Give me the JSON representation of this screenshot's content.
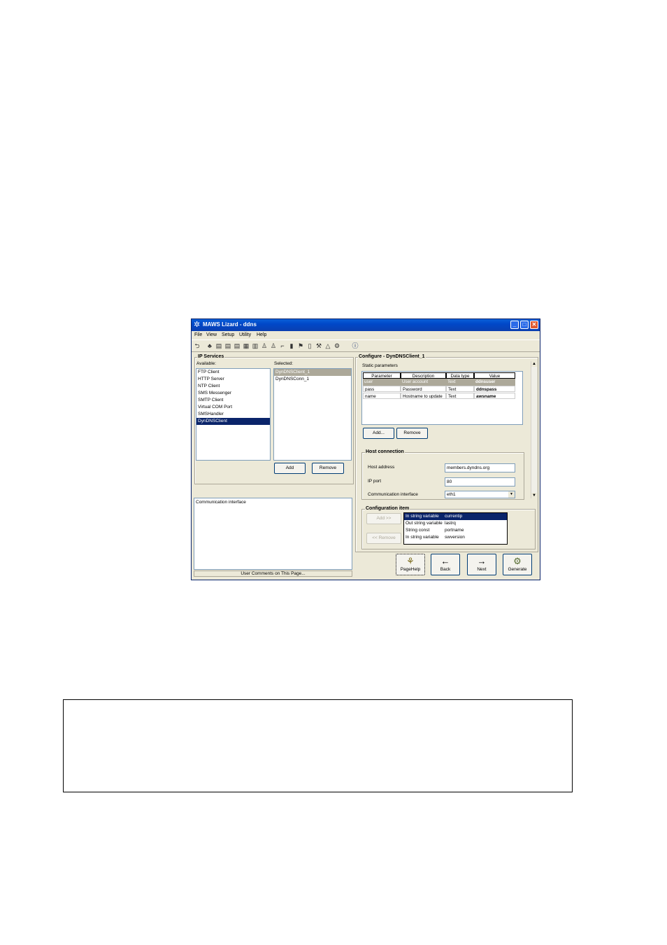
{
  "window": {
    "title": "MAWS Lizard - ddns"
  },
  "menu": [
    "File",
    "View",
    "Setup",
    "Utility",
    "Help"
  ],
  "toolbar_icons": [
    "back-icon",
    "tree-icon",
    "dcv-icon",
    "dcv-icon",
    "dcv-icon",
    "grid-icon",
    "dcv-icon",
    "figure-icon",
    "figure-icon",
    "chart-icon",
    "device-icon",
    "network-icon",
    "page-icon",
    "wrench-icon",
    "bell-icon",
    "gear-icon",
    "info-icon"
  ],
  "ip_services": {
    "title": "IP Services",
    "available_label": "Available:",
    "selected_label": "Selected:",
    "available": [
      "FTP Client",
      "HTTP Server",
      "NTP Client",
      "SMS Messenger",
      "SMTP Client",
      "Virtual COM Port",
      "SMSHandler",
      "DynDNSClient"
    ],
    "selected": [
      "DynDNSClient_1",
      "DynDNSConn_1"
    ],
    "add_label": "Add",
    "remove_label": "Remove"
  },
  "comment": {
    "text": "Communication interface",
    "footer": "User Comments on This Page..."
  },
  "configure": {
    "title": "Configure - DynDNSClient_1",
    "static_label": "Static parameters",
    "columns": [
      "Parameter",
      "Description",
      "Data type",
      "Value"
    ],
    "rows": [
      [
        "user",
        "User account",
        "Text",
        "ddnsuser"
      ],
      [
        "pass",
        "Password",
        "Text",
        "ddnspass"
      ],
      [
        "name",
        "Hostname to update",
        "Text",
        "awsname"
      ]
    ],
    "add_label": "Add...",
    "remove_label": "Remove"
  },
  "host": {
    "title": "Host connection",
    "host_label": "Host address",
    "host_value": "members.dyndns.org",
    "port_label": "IP port",
    "port_value": "80",
    "iface_label": "Communication interface",
    "iface_value": "eth1"
  },
  "config_item": {
    "title": "Configuration item",
    "add_label": "Add >>",
    "remove_label": "<< Remove",
    "items": [
      [
        "In string variable",
        "currentip"
      ],
      [
        "Out string variable",
        "lastrq"
      ],
      [
        "String const",
        "portname"
      ],
      [
        "In string variable",
        "swversion"
      ]
    ]
  },
  "nav": {
    "pagehelp": "PageHelp",
    "back": "Back",
    "next": "Next",
    "generate": "Generate"
  }
}
